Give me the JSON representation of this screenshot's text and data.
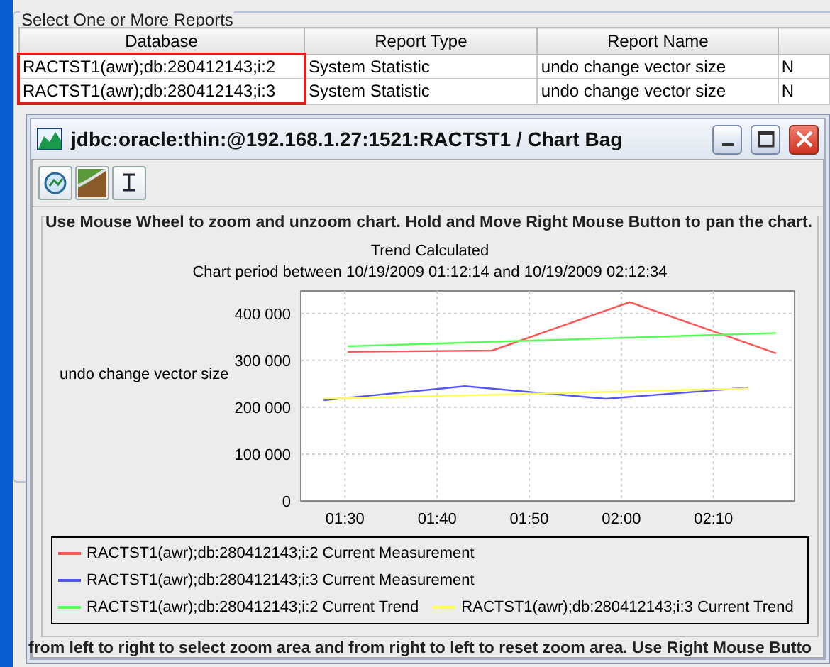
{
  "reports_panel": {
    "title": "Select One or More Reports",
    "table": {
      "columns": [
        "Database",
        "Report Type",
        "Report Name"
      ],
      "rows": [
        {
          "cells": [
            "RACTST1(awr);db:280412143;i:2",
            "System Statistic",
            "undo change vector size",
            "N"
          ],
          "selected": true
        },
        {
          "cells": [
            "RACTST1(awr);db:280412143;i:3",
            "System Statistic",
            "undo change vector size",
            "N"
          ],
          "selected": true
        }
      ]
    }
  },
  "chart_window": {
    "title": "jdbc:oracle:thin:@192.168.1.27:1521:RACTST1 / Chart Bag",
    "toolbar": [
      {
        "kind": "zoom"
      },
      {
        "kind": "chart"
      },
      {
        "kind": "text"
      }
    ],
    "instructions": "Use Mouse Wheel to zoom and unzoom chart. Hold and Move Right Mouse Button to pan the chart.",
    "chart_data": {
      "type": "line",
      "title": "Trend Calculated",
      "subtitle": "Chart period between 10/19/2009 01:12:14 and 10/19/2009 02:12:34",
      "ylabel": "undo change vector size",
      "grid": true,
      "xlim": [
        85.2,
        138.8
      ],
      "ylim": [
        0,
        448000
      ],
      "xticks": [
        {
          "value": 90,
          "label": "01:30"
        },
        {
          "value": 100,
          "label": "01:40"
        },
        {
          "value": 110,
          "label": "01:50"
        },
        {
          "value": 120,
          "label": "02:00"
        },
        {
          "value": 130,
          "label": "02:10"
        }
      ],
      "yticks": [
        {
          "value": 0,
          "label": "0"
        },
        {
          "value": 100000,
          "label": "100 000"
        },
        {
          "value": 200000,
          "label": "200 000"
        },
        {
          "value": 300000,
          "label": "300 000"
        },
        {
          "value": 400000,
          "label": "400 000"
        }
      ],
      "series": [
        {
          "name": "RACTST1(awr);db:280412143;i:2 Current Measurement",
          "color": "#ff5555",
          "x": [
            90.3,
            106,
            120.9,
            136.8
          ],
          "values": [
            318000,
            321000,
            424000,
            315000
          ]
        },
        {
          "name": "RACTST1(awr);db:280412143;i:3 Current Measurement",
          "color": "#5555ff",
          "x": [
            87.7,
            103,
            118.3,
            133.8
          ],
          "values": [
            215000,
            245000,
            218000,
            242000
          ]
        },
        {
          "name": "RACTST1(awr);db:280412143;i:2 Current Trend",
          "color": "#55ff55",
          "x": [
            90.3,
            136.8
          ],
          "values": [
            330000,
            358000
          ]
        },
        {
          "name": "RACTST1(awr);db:280412143;i:3 Current Trend",
          "color": "#ffff55",
          "x": [
            87.7,
            133.8
          ],
          "values": [
            218000,
            240000
          ]
        }
      ]
    },
    "status_text": "from left to right to select zoom area and from right to left to reset zoom area. Use Right Mouse Butto"
  }
}
